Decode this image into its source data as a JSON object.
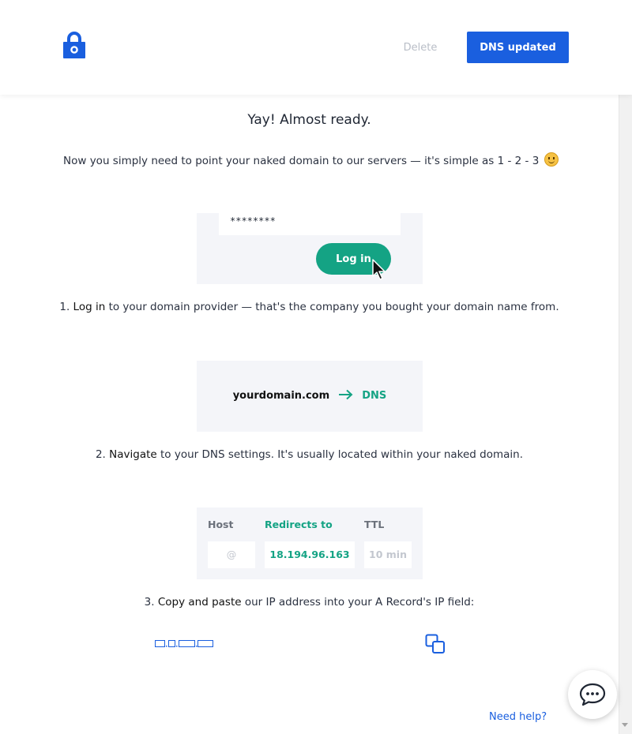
{
  "header": {
    "logo_icon": "padlock-icon",
    "delete_label": "Delete",
    "dns_updated_label": "DNS updated",
    "accent_color": "#1a5fdf"
  },
  "main": {
    "title": "Yay! Almost ready.",
    "intro": "Now you simply need to point your naked domain to our servers — it's simple as 1 - 2 - 3",
    "intro_emoji_icon": "smiley-icon",
    "steps": [
      {
        "illustration": {
          "password_mask": "********",
          "login_button_label": "Log in",
          "cursor_icon": "mouse-pointer-icon"
        },
        "prefix": "1.",
        "bold": "Log in",
        "text": "to your domain provider — that's the company you bought your domain name from."
      },
      {
        "illustration": {
          "domain": "yourdomain.com",
          "arrow_icon": "arrow-right-icon",
          "destination": "DNS"
        },
        "prefix": "2.",
        "bold": "Navigate",
        "text": "to your DNS settings. It's usually located within your naked domain."
      },
      {
        "illustration": {
          "columns": [
            "Host",
            "Redirects to",
            "TTL"
          ],
          "values": [
            "@",
            "18.194.96.163",
            "10 min"
          ]
        },
        "prefix": "3.",
        "bold": "Copy and paste",
        "text": "our IP address into your A Record's IP field:"
      }
    ],
    "copy_icon": "copy-icon",
    "success_color": "#14a384"
  },
  "footer": {
    "chat_icon": "chat-bubble-icon",
    "help_link": "Need help?"
  }
}
